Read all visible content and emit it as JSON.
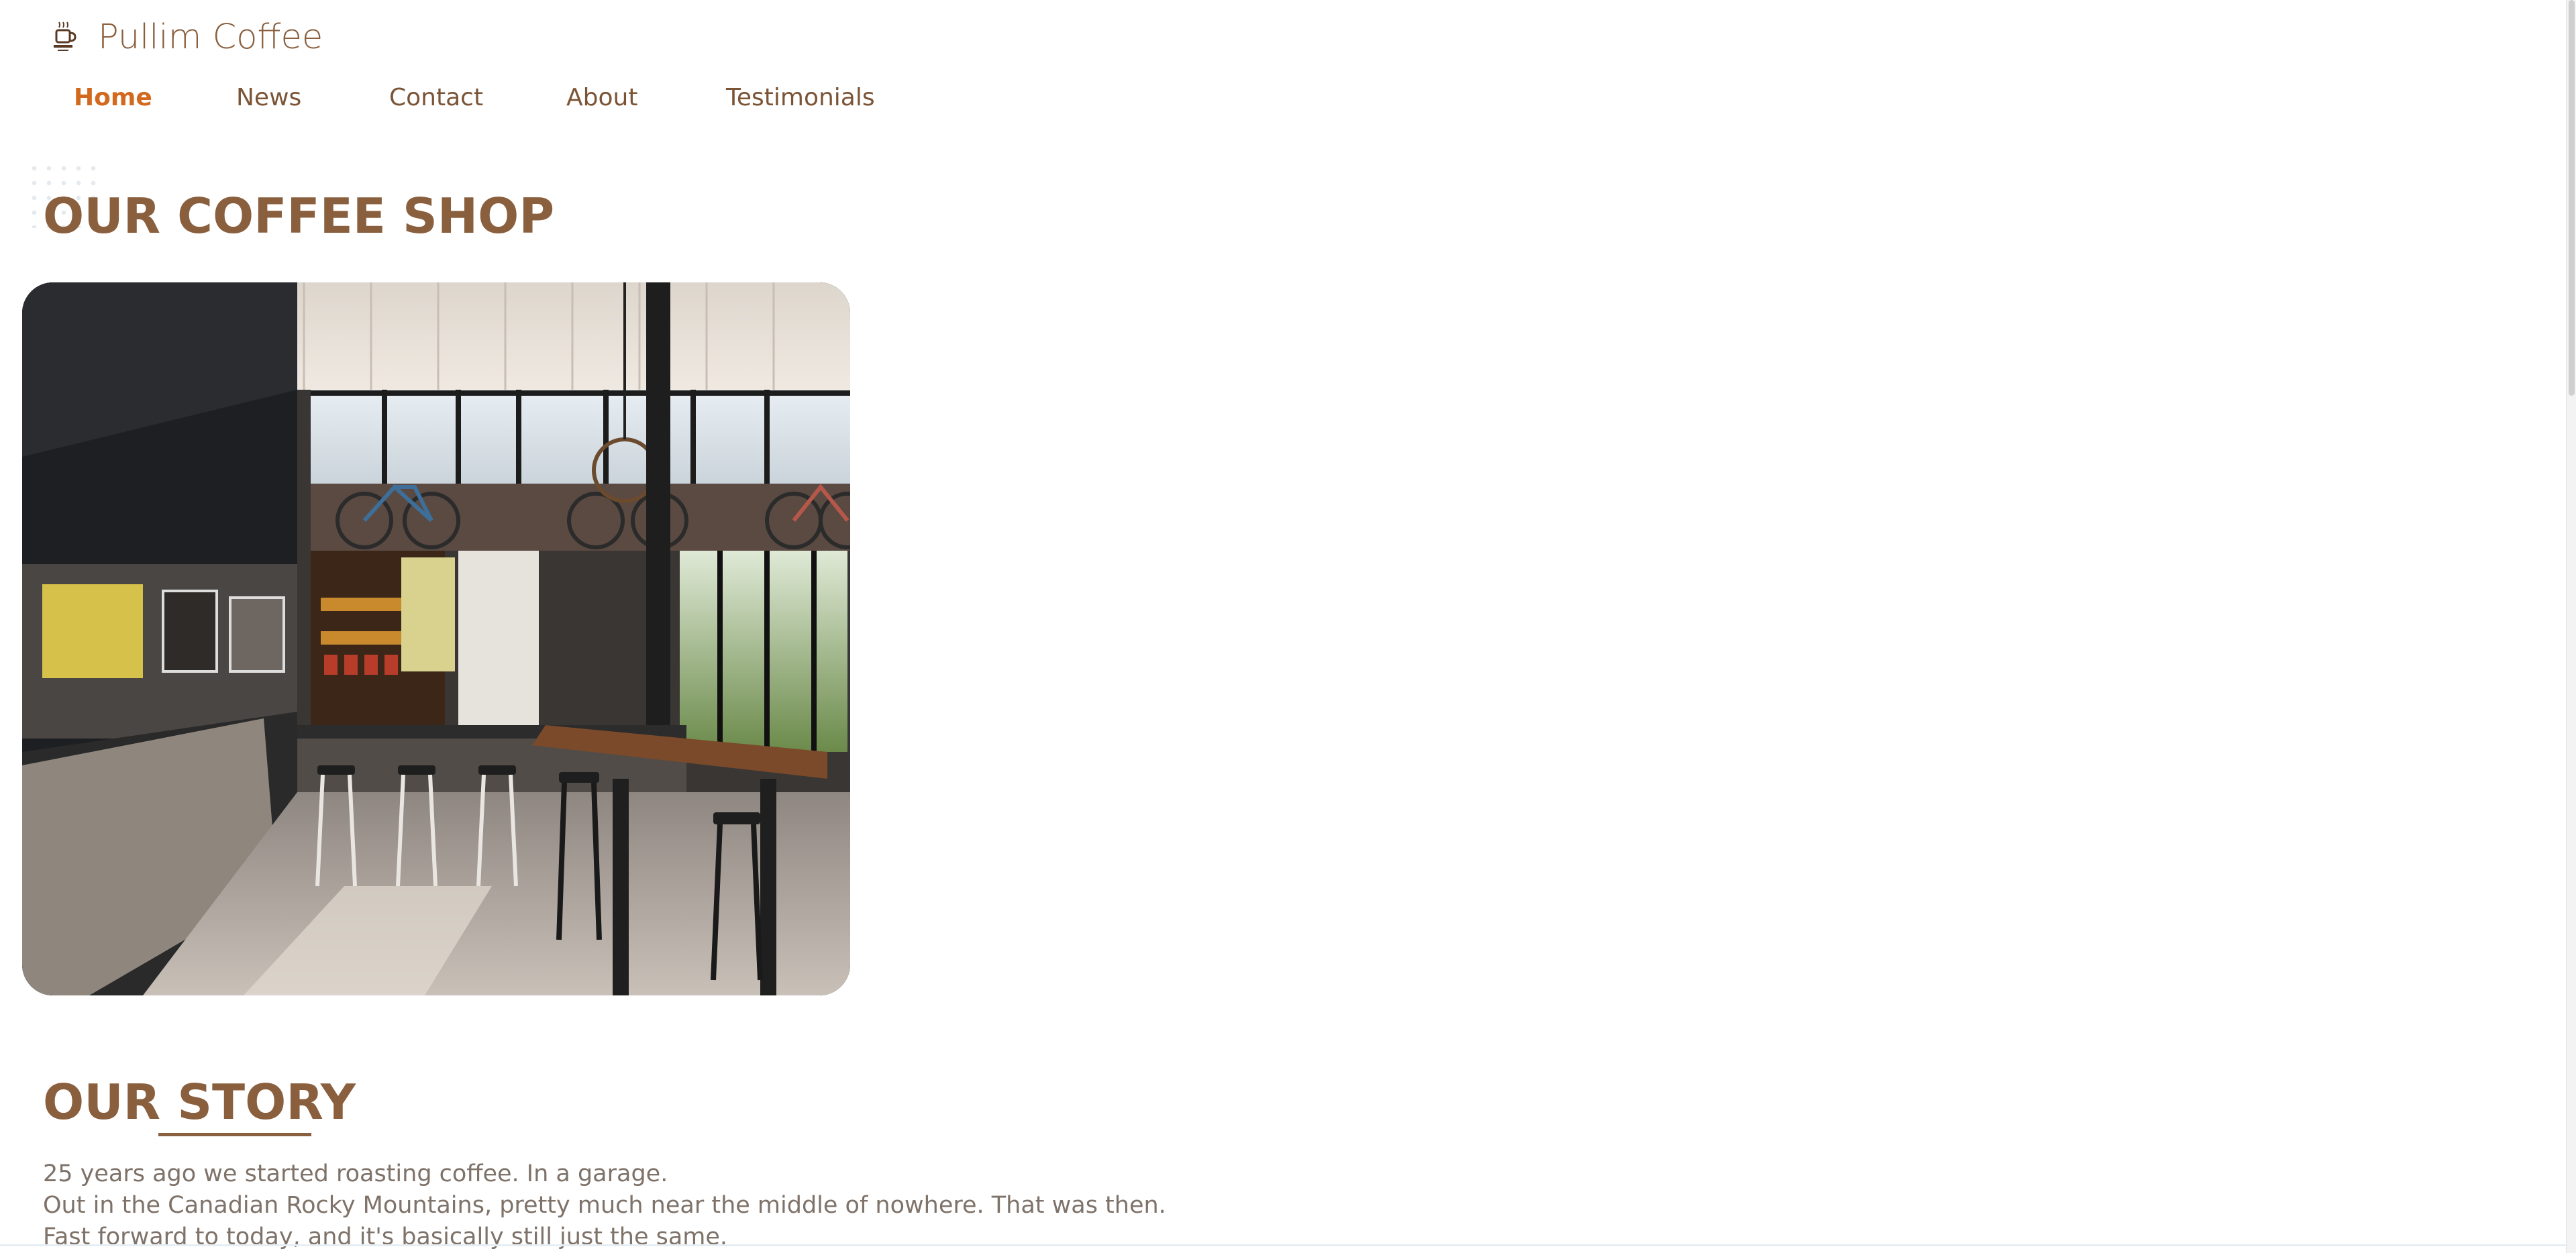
{
  "brand": {
    "name": "Pullim Coffee",
    "logo_icon": "coffee-cup-logo-icon"
  },
  "nav": {
    "items": [
      {
        "label": "Home",
        "active": true
      },
      {
        "label": "News",
        "active": false
      },
      {
        "label": "Contact",
        "active": false
      },
      {
        "label": "About",
        "active": false
      },
      {
        "label": "Testimonials",
        "active": false
      }
    ]
  },
  "sections": {
    "shop": {
      "title": "OUR COFFEE SHOP",
      "image_alt": "cafe-interior-photo"
    },
    "story": {
      "title_part1": "OUR ",
      "title_part2": "STORY",
      "paragraphs": [
        "25 years ago we started roasting coffee. In a garage.",
        "Out in the Canadian Rocky Mountains, pretty much near the middle of nowhere. That was then.",
        "Fast forward to today, and it's basically still just the same."
      ]
    }
  },
  "colors": {
    "brand_brown": "#8a5f3d",
    "nav_active": "#d2691e",
    "body_text": "#7e7269"
  }
}
